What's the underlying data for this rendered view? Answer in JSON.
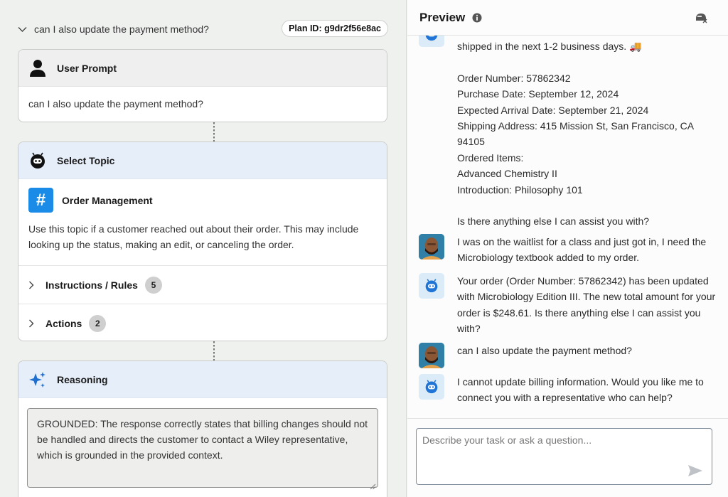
{
  "plan": {
    "question": "can I also update the payment method?",
    "plan_id": "Plan ID: g9dr2f56e8ac"
  },
  "user_prompt": {
    "title": "User Prompt",
    "text": "can I also update the payment method?"
  },
  "select_topic": {
    "title": "Select Topic",
    "topic_name": "Order Management",
    "topic_badge": "#",
    "description": "Use this topic if a customer reached out about their order. This may include looking up the status, making an edit, or canceling the order.",
    "rows": [
      {
        "label": "Instructions / Rules",
        "count": "5"
      },
      {
        "label": "Actions",
        "count": "2"
      }
    ]
  },
  "reasoning": {
    "title": "Reasoning",
    "text": "GROUNDED: The response correctly states that billing changes should not be handled and directs the customer to contact a Wiley representative, which is grounded in the provided context."
  },
  "preview": {
    "title": "Preview",
    "messages": [
      {
        "sender": "bot",
        "text": "shipped in the next 1-2 business days. 🚚\n\nOrder Number: 57862342\nPurchase Date: September 12, 2024\nExpected Arrival Date: September 21, 2024\nShipping Address: 415 Mission St, San Francisco, CA 94105\nOrdered Items:\nAdvanced Chemistry II\nIntroduction: Philosophy 101\n\nIs there anything else I can assist you with?"
      },
      {
        "sender": "user",
        "text": "I was on the waitlist for a class and just got in, I need the Microbiology textbook added to my order."
      },
      {
        "sender": "bot",
        "text": "Your order (Order Number: 57862342) has been updated with Microbiology Edition III. The new total amount for your order is $248.61. Is there anything else I can assist you with?"
      },
      {
        "sender": "user",
        "text": "can I also update the payment method?"
      },
      {
        "sender": "bot",
        "text": "I cannot update billing information. Would you like me to connect you with a representative who can help?"
      }
    ],
    "composer_placeholder": "Describe your task or ask a question..."
  },
  "colors": {
    "accent": "#1a8be6",
    "bot_avatar_bg": "#dcebf8",
    "header_blue": "#e6eef9"
  }
}
